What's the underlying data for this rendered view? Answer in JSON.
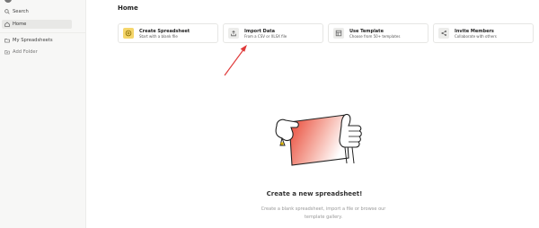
{
  "sidebar": {
    "items": [
      {
        "label": "Search",
        "icon": "search-icon"
      },
      {
        "label": "Home",
        "icon": "home-icon",
        "active": true
      },
      {
        "label": "My Spreadsheets",
        "icon": "folder-icon"
      },
      {
        "label": "Add Folder",
        "icon": "add-folder-icon"
      }
    ]
  },
  "main": {
    "title": "Home",
    "cards": [
      {
        "title": "Create Spreadsheet",
        "subtitle": "Start with a blank file",
        "icon": "plus-icon",
        "icon_bg": "#f5d66b"
      },
      {
        "title": "Import Data",
        "subtitle": "From a CSV or XLSX file",
        "icon": "upload-icon",
        "icon_bg": "#ececea"
      },
      {
        "title": "Use Template",
        "subtitle": "Choose from 50+ templates",
        "icon": "template-icon",
        "icon_bg": "#ececea"
      },
      {
        "title": "Invite Members",
        "subtitle": "Collaborate with others",
        "icon": "share-icon",
        "icon_bg": "#ececea"
      }
    ],
    "empty_state": {
      "title": "Create a new spreadsheet!",
      "description_line1": "Create a blank spreadsheet, import a file or browse our",
      "description_line2": "template gallery."
    }
  },
  "colors": {
    "accent_yellow": "#f5d66b",
    "arrow_red": "#e03a3a",
    "illustration_red": "#ec4a3a"
  }
}
